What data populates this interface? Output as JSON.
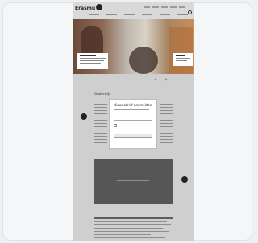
{
  "header": {
    "logo_text": "Erasmus"
  },
  "hero": {
    "nav": {
      "prev_icon": "chevron-left-icon",
      "next_icon": "chevron-right-icon"
    }
  },
  "content": {
    "section_title": "Onderwijs"
  },
  "modal": {
    "title": "Nieuwsbrief aanmelden"
  },
  "icons": {
    "search": "search-icon"
  }
}
